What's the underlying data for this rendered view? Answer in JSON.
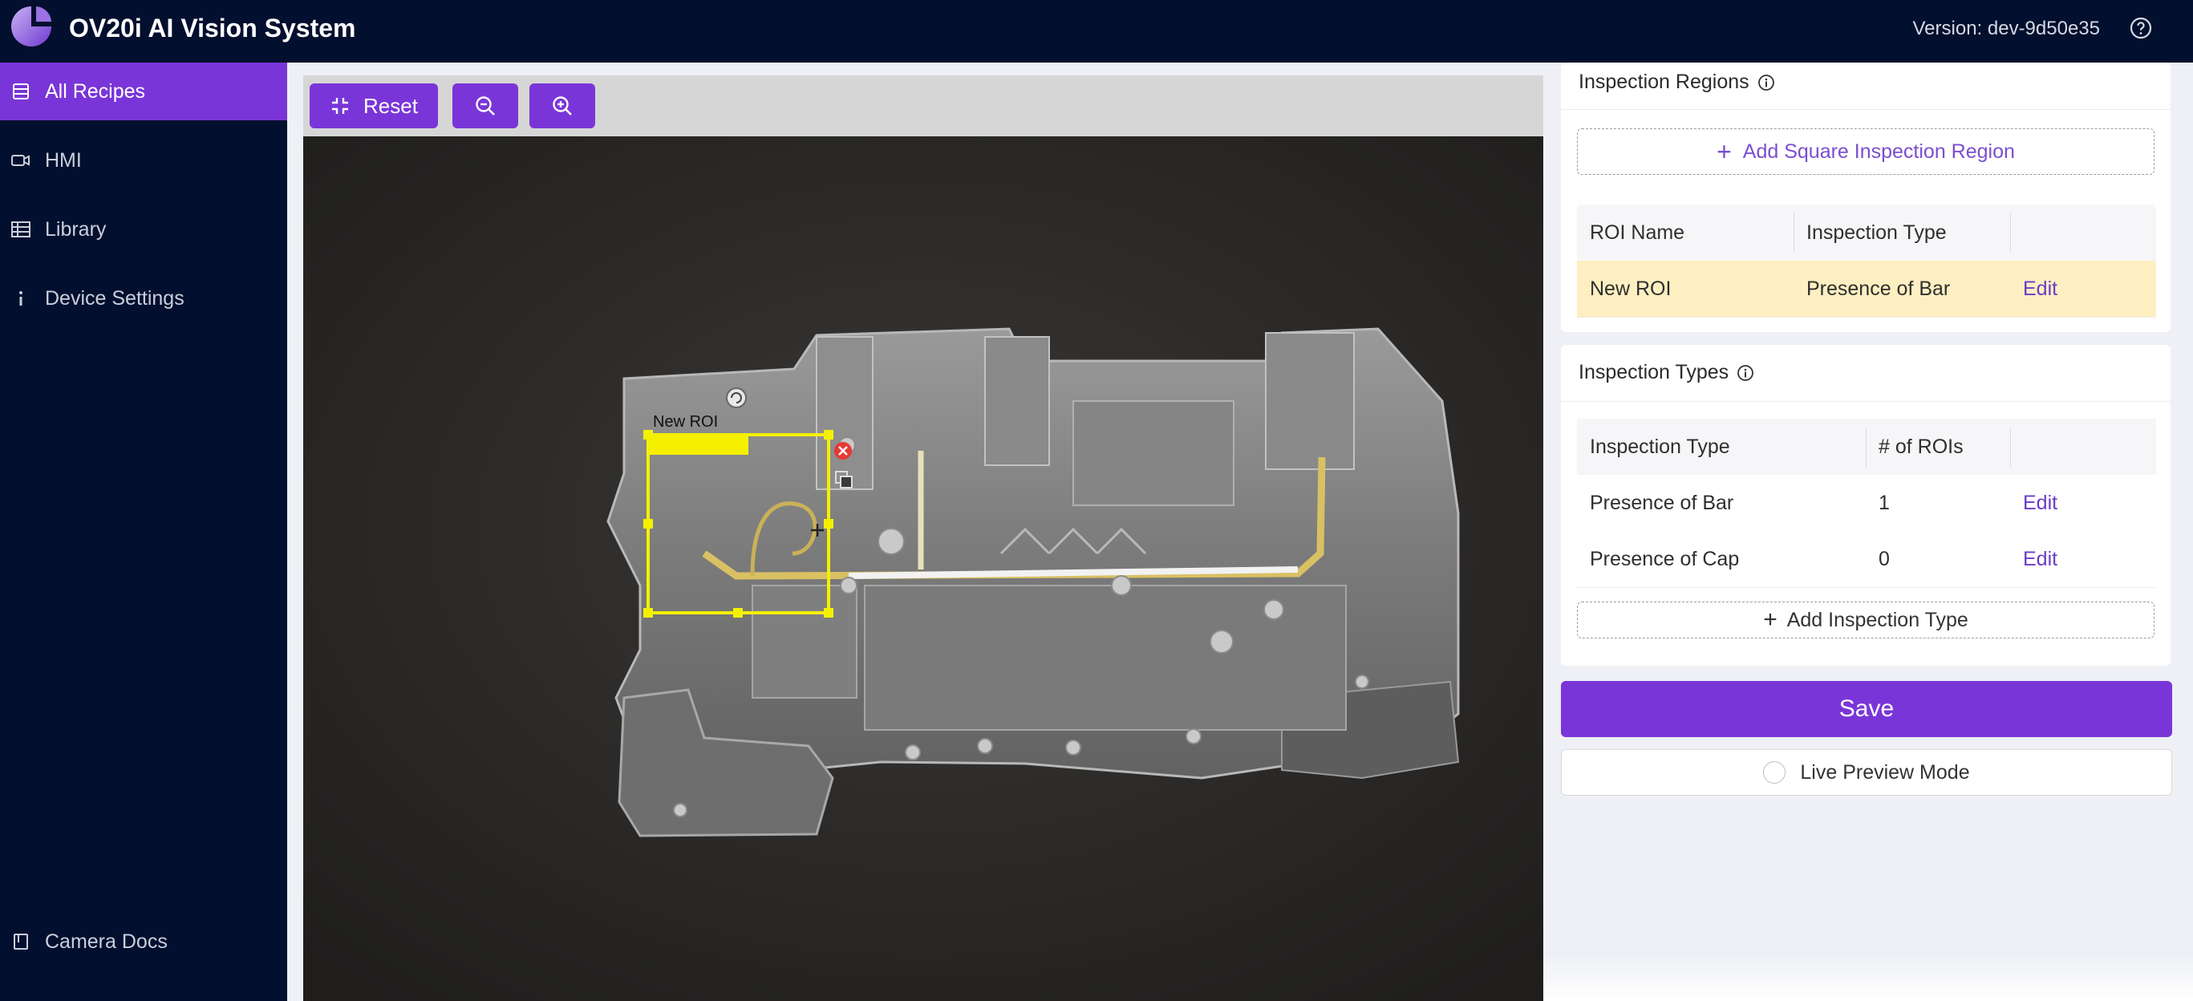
{
  "header": {
    "title": "OV20i AI Vision System",
    "version": "Version: dev-9d50e35",
    "help_icon": "help-circle-icon"
  },
  "sidebar": {
    "items": [
      {
        "label": "All Recipes",
        "icon": "list-icon",
        "active": true
      },
      {
        "label": "HMI",
        "icon": "camera-icon",
        "active": false
      },
      {
        "label": "Library",
        "icon": "table-icon",
        "active": false
      },
      {
        "label": "Device Settings",
        "icon": "info-icon",
        "active": false
      }
    ],
    "footer": {
      "label": "Camera Docs",
      "icon": "book-icon"
    }
  },
  "toolbar": {
    "reset_label": "Reset",
    "zoom_out_icon": "zoom-out-icon",
    "zoom_in_icon": "zoom-in-icon"
  },
  "viewer": {
    "roi_label": "New ROI"
  },
  "inspection_regions": {
    "title": "Inspection Regions",
    "add_button": "Add Square Inspection Region",
    "columns": [
      "ROI Name",
      "Inspection Type"
    ],
    "rows": [
      {
        "name": "New ROI",
        "type": "Presence of Bar",
        "action": "Edit"
      }
    ]
  },
  "inspection_types": {
    "title": "Inspection Types",
    "columns": [
      "Inspection Type",
      "# of ROIs"
    ],
    "rows": [
      {
        "type": "Presence of Bar",
        "count": "1",
        "action": "Edit"
      },
      {
        "type": "Presence of Cap",
        "count": "0",
        "action": "Edit"
      }
    ],
    "add_button": "Add Inspection Type"
  },
  "save_label": "Save",
  "live_preview_label": "Live Preview Mode",
  "colors": {
    "accent": "#7a35d8",
    "header_bg": "#030f2e",
    "roi": "#f4f000",
    "highlight_row": "#fdefc1"
  }
}
